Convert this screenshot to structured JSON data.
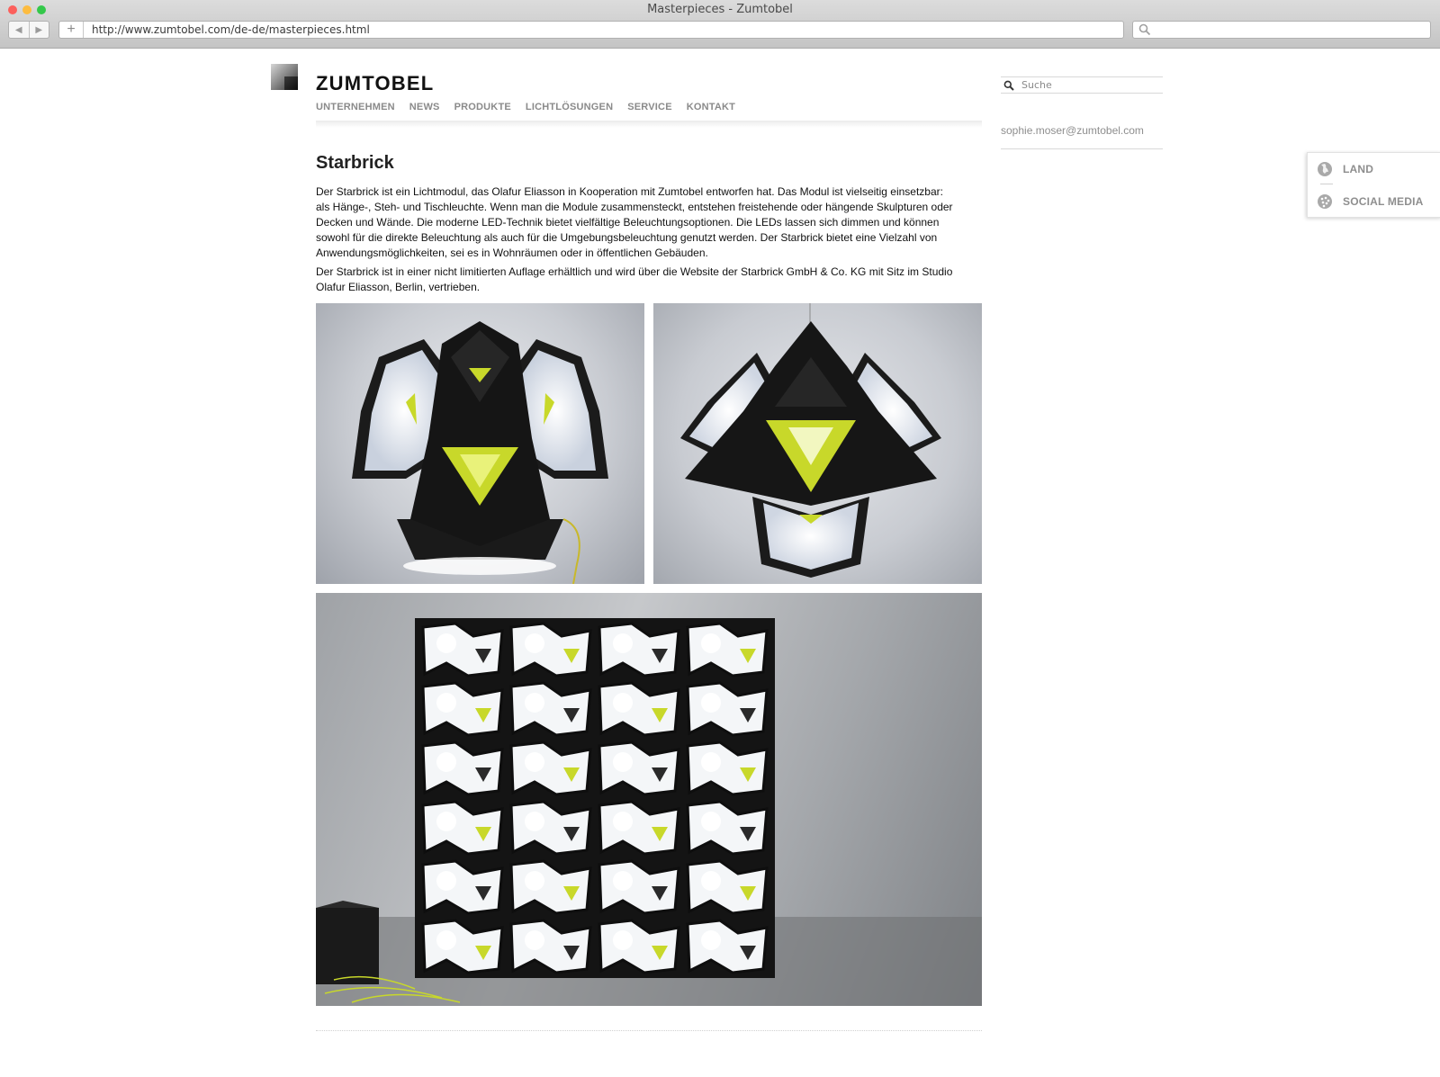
{
  "browser": {
    "window_title": "Masterpieces - Zumtobel",
    "url": "http://www.zumtobel.com/de-de/masterpieces.html"
  },
  "header": {
    "logo_text": "ZUMTOBEL",
    "nav": [
      "UNTERNEHMEN",
      "NEWS",
      "PRODUKTE",
      "LICHTLÖSUNGEN",
      "SERVICE",
      "KONTAKT"
    ],
    "search_placeholder": "Suche",
    "user_email": "sophie.moser@zumtobel.com"
  },
  "flyout": {
    "land_label": "LAND",
    "social_label": "SOCIAL MEDIA"
  },
  "content": {
    "title": "Starbrick",
    "paragraphs": [
      "Der Starbrick ist ein Lichtmodul, das Olafur Eliasson in Kooperation mit Zumtobel entworfen hat. Das Modul ist vielseitig einsetzbar: als Hänge-, Steh- und Tischleuchte. Wenn man die Module zusammensteckt, entstehen freistehende oder hängende Skulpturen oder Decken und Wände. Die moderne LED-Technik bietet vielfältige Beleuchtungsoptionen. Die LEDs lassen sich dimmen und können sowohl für die direkte Beleuchtung als auch für die Umgebungsbeleuchtung genutzt werden. Der Starbrick bietet eine Vielzahl von Anwendungsmöglichkeiten, sei es in Wohnräumen oder in öffentlichen Gebäuden.",
      "Der Starbrick ist in einer nicht limitierten Auflage erhältlich und wird über die Website der Starbrick GmbH & Co. KG mit Sitz im Studio Olafur Eliasson, Berlin, vertrieben."
    ]
  },
  "colors": {
    "accent_yellow": "#c8d82a",
    "nav_grey": "#8a8a8a",
    "text": "#111111"
  }
}
